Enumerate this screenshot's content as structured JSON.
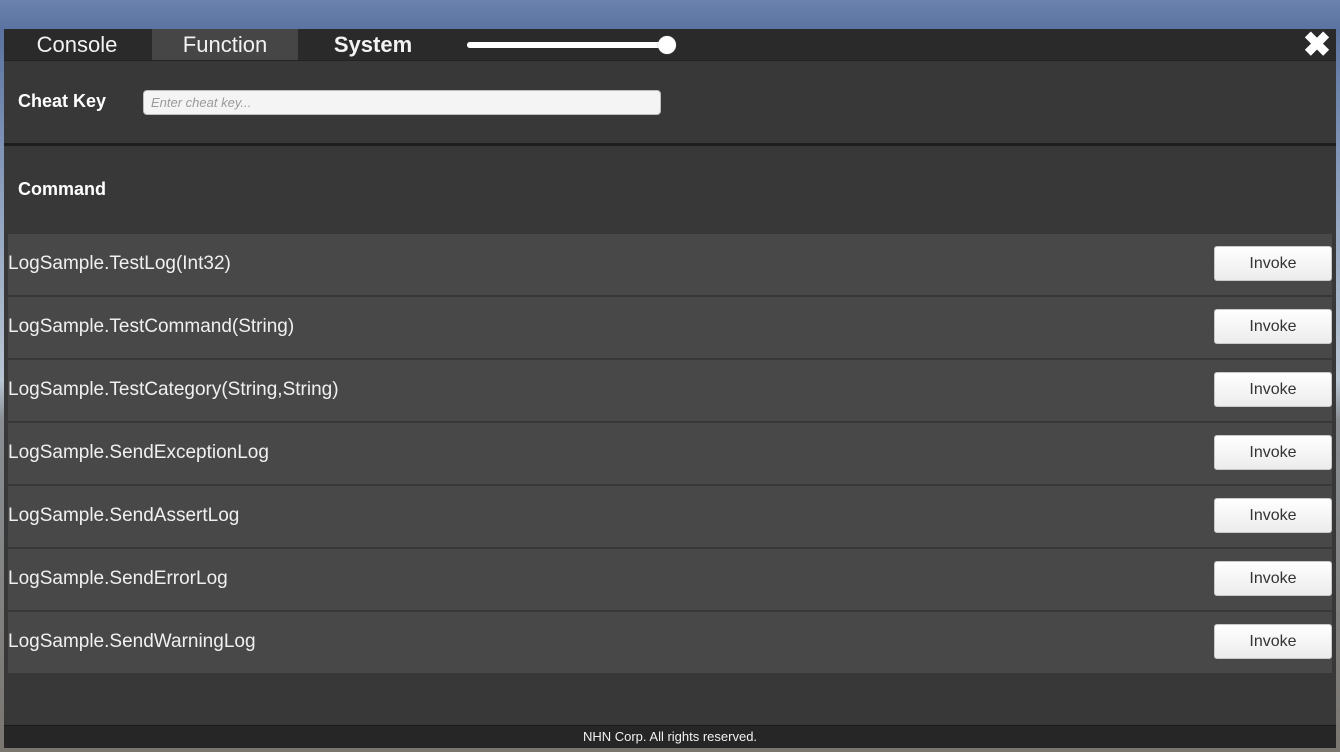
{
  "tabs": {
    "console": "Console",
    "function": "Function",
    "system": "System"
  },
  "slider": {
    "value": 1.0
  },
  "close_icon": "close-x-icon",
  "cheat": {
    "label": "Cheat Key",
    "placeholder": "Enter cheat key...",
    "value": ""
  },
  "command": {
    "title": "Command",
    "items": [
      {
        "name": "LogSample.TestLog(Int32)",
        "button": "Invoke"
      },
      {
        "name": "LogSample.TestCommand(String)",
        "button": "Invoke"
      },
      {
        "name": "LogSample.TestCategory(String,String)",
        "button": "Invoke"
      },
      {
        "name": "LogSample.SendExceptionLog",
        "button": "Invoke"
      },
      {
        "name": "LogSample.SendAssertLog",
        "button": "Invoke"
      },
      {
        "name": "LogSample.SendErrorLog",
        "button": "Invoke"
      },
      {
        "name": "LogSample.SendWarningLog",
        "button": "Invoke"
      }
    ]
  },
  "footer": {
    "text": "NHN Corp. All rights reserved."
  },
  "colors": {
    "panel": "#383838",
    "tabbar": "#2a2a2a",
    "active_tab": "#464646",
    "row": "#484848"
  }
}
